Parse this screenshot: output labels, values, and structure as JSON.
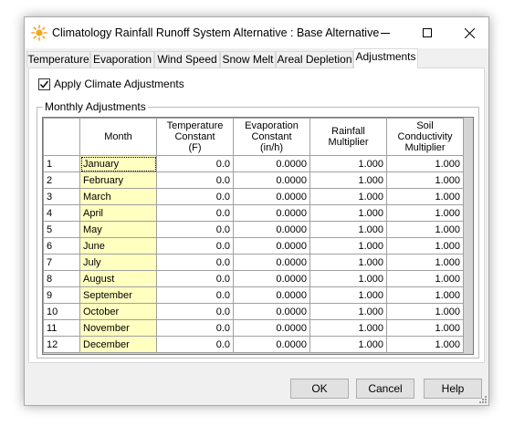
{
  "window": {
    "title": "Climatology Rainfall Runoff System Alternative : Base Alternative",
    "icon": "sun-icon",
    "controls": {
      "minimize": "minimize-icon",
      "maximize": "maximize-icon",
      "close": "close-icon"
    }
  },
  "tabs": [
    {
      "label": "Temperature",
      "active": false
    },
    {
      "label": "Evaporation",
      "active": false
    },
    {
      "label": "Wind Speed",
      "active": false
    },
    {
      "label": "Snow Melt",
      "active": false
    },
    {
      "label": "Areal Depletion",
      "active": false
    },
    {
      "label": "Adjustments",
      "active": true
    }
  ],
  "apply_checkbox": {
    "label": "Apply Climate Adjustments",
    "checked": true
  },
  "group": {
    "title": "Monthly Adjustments"
  },
  "table": {
    "headers": {
      "month": "Month",
      "temp": [
        "Temperature",
        "Constant",
        "(F)"
      ],
      "evap": [
        "Evaporation",
        "Constant",
        "(in/h)"
      ],
      "rain": [
        "Rainfall",
        "Multiplier"
      ],
      "soil": [
        "Soil",
        "Conductivity",
        "Multiplier"
      ]
    },
    "rows": [
      {
        "idx": "1",
        "month": "January",
        "temp": "0.0",
        "evap": "0.0000",
        "rain": "1.000",
        "soil": "1.000"
      },
      {
        "idx": "2",
        "month": "February",
        "temp": "0.0",
        "evap": "0.0000",
        "rain": "1.000",
        "soil": "1.000"
      },
      {
        "idx": "3",
        "month": "March",
        "temp": "0.0",
        "evap": "0.0000",
        "rain": "1.000",
        "soil": "1.000"
      },
      {
        "idx": "4",
        "month": "April",
        "temp": "0.0",
        "evap": "0.0000",
        "rain": "1.000",
        "soil": "1.000"
      },
      {
        "idx": "5",
        "month": "May",
        "temp": "0.0",
        "evap": "0.0000",
        "rain": "1.000",
        "soil": "1.000"
      },
      {
        "idx": "6",
        "month": "June",
        "temp": "0.0",
        "evap": "0.0000",
        "rain": "1.000",
        "soil": "1.000"
      },
      {
        "idx": "7",
        "month": "July",
        "temp": "0.0",
        "evap": "0.0000",
        "rain": "1.000",
        "soil": "1.000"
      },
      {
        "idx": "8",
        "month": "August",
        "temp": "0.0",
        "evap": "0.0000",
        "rain": "1.000",
        "soil": "1.000"
      },
      {
        "idx": "9",
        "month": "September",
        "temp": "0.0",
        "evap": "0.0000",
        "rain": "1.000",
        "soil": "1.000"
      },
      {
        "idx": "10",
        "month": "October",
        "temp": "0.0",
        "evap": "0.0000",
        "rain": "1.000",
        "soil": "1.000"
      },
      {
        "idx": "11",
        "month": "November",
        "temp": "0.0",
        "evap": "0.0000",
        "rain": "1.000",
        "soil": "1.000"
      },
      {
        "idx": "12",
        "month": "December",
        "temp": "0.0",
        "evap": "0.0000",
        "rain": "1.000",
        "soil": "1.000"
      }
    ]
  },
  "buttons": {
    "ok": "OK",
    "cancel": "Cancel",
    "help": "Help"
  },
  "colors": {
    "month_cell": "#ffffc0",
    "sun": "#f5a623"
  }
}
